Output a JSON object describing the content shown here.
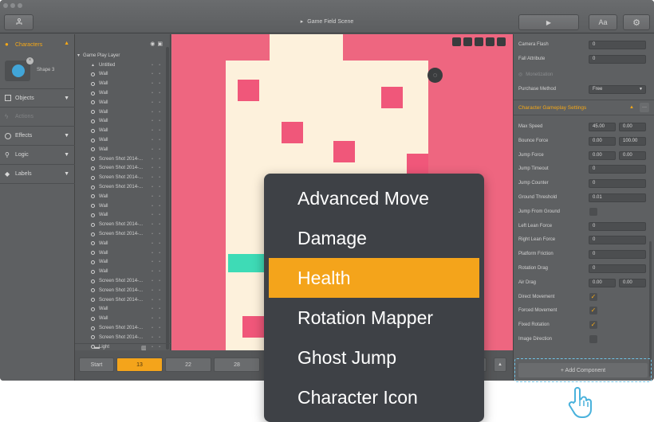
{
  "window": {
    "scene_title": "Game Field Scene",
    "toolbar": {
      "play_icon": "play-icon",
      "font_label": "Aa",
      "settings_icon": "gear-icon",
      "hierarchy_icon": "hierarchy-icon"
    }
  },
  "left_panel": {
    "sections": [
      {
        "label": "Characters",
        "icon": "person-icon",
        "active": true
      },
      {
        "label": "Objects",
        "icon": "cube-icon"
      },
      {
        "label": "Actions",
        "icon": "bolt-icon",
        "disabled": true
      },
      {
        "label": "Effects",
        "icon": "effects-icon"
      },
      {
        "label": "Logic",
        "icon": "logic-icon"
      },
      {
        "label": "Labels",
        "icon": "tag-icon"
      }
    ],
    "character_shape": "Shape 3",
    "accent": "#f5a817"
  },
  "layer_panel": {
    "header_icons": [
      "eye-icon",
      "lock-icon"
    ],
    "rows": [
      {
        "label": "Game Play Layer",
        "type": "layer"
      },
      {
        "label": "Untitled",
        "type": "person"
      },
      {
        "label": "Wall"
      },
      {
        "label": "Wall"
      },
      {
        "label": "Wall"
      },
      {
        "label": "Wall"
      },
      {
        "label": "Wall"
      },
      {
        "label": "Wall"
      },
      {
        "label": "Wall"
      },
      {
        "label": "Wall"
      },
      {
        "label": "Wall"
      },
      {
        "label": "Screen Shot 2014-..."
      },
      {
        "label": "Screen Shot 2014-..."
      },
      {
        "label": "Screen Shot 2014-..."
      },
      {
        "label": "Screen Shot 2014-..."
      },
      {
        "label": "Wall"
      },
      {
        "label": "Wall"
      },
      {
        "label": "Wall"
      },
      {
        "label": "Screen Shot 2014-..."
      },
      {
        "label": "Screen Shot 2014-..."
      },
      {
        "label": "Wall"
      },
      {
        "label": "Wall"
      },
      {
        "label": "Wall"
      },
      {
        "label": "Wall"
      },
      {
        "label": "Screen Shot 2014-..."
      },
      {
        "label": "Screen Shot 2014-..."
      },
      {
        "label": "Screen Shot 2014-..."
      },
      {
        "label": "Wall"
      },
      {
        "label": "Wall"
      },
      {
        "label": "Screen Shot 2014-..."
      },
      {
        "label": "Screen Shot 2014-..."
      },
      {
        "label": "Light"
      }
    ],
    "footer_icons": [
      "folder-icon",
      "trash-icon"
    ]
  },
  "canvas": {
    "background": "#ee6680",
    "building_color": "#fdf1dc",
    "block_color": "#f0577a",
    "platform_color": "#3edbb6",
    "toolbar_icons": [
      "fit-icon",
      "lock-icon",
      "pin-icon",
      "eye-icon",
      "bug-icon"
    ],
    "light_icon": "bulb-icon"
  },
  "timeline": {
    "start_label": "Start",
    "frames": [
      "13",
      "22",
      "28"
    ],
    "active_frame": "13"
  },
  "right_panel": {
    "top_props": [
      {
        "label": "Camera Flash",
        "value": "0"
      },
      {
        "label": "Fall Attribute",
        "value": "0"
      }
    ],
    "monetization": {
      "label": "Monetization",
      "method_label": "Purchase Method",
      "method_value": "Free"
    },
    "gameplay_section": "Character Gameplay Settings",
    "gameplay_props": [
      {
        "label": "Max Speed",
        "values": [
          "45.00",
          "0.00"
        ]
      },
      {
        "label": "Bounce Force",
        "values": [
          "0.00",
          "100.00"
        ]
      },
      {
        "label": "Jump Force",
        "values": [
          "0.00",
          "0.00"
        ]
      },
      {
        "label": "Jump Timeout",
        "values": [
          "0"
        ]
      },
      {
        "label": "Jump Counter",
        "values": [
          "0"
        ]
      },
      {
        "label": "Ground Threshold",
        "values": [
          "0.01"
        ]
      },
      {
        "label": "Jump From Ground",
        "check": false
      },
      {
        "label": "Left Lean Force",
        "values": [
          "0"
        ]
      },
      {
        "label": "Right Lean Force",
        "values": [
          "0"
        ]
      },
      {
        "label": "Platform Friction",
        "values": [
          "0"
        ]
      },
      {
        "label": "Rotation Drag",
        "values": [
          "0"
        ]
      },
      {
        "label": "Air Drag",
        "values": [
          "0.00",
          "0.00"
        ]
      },
      {
        "label": "Direct Movement",
        "check": true
      },
      {
        "label": "Forced Movement",
        "check": true
      },
      {
        "label": "Fixed Rotation",
        "check": true
      },
      {
        "label": "Image Direction",
        "check": false
      }
    ],
    "add_component": "+ Add Component"
  },
  "dropdown": {
    "items": [
      "Advanced Move",
      "Damage",
      "Health",
      "Rotation Mapper",
      "Ghost Jump",
      "Character Icon"
    ],
    "active": "Health",
    "active_color": "#f4a41b"
  },
  "cursor_icon": "hand-pointer-icon"
}
